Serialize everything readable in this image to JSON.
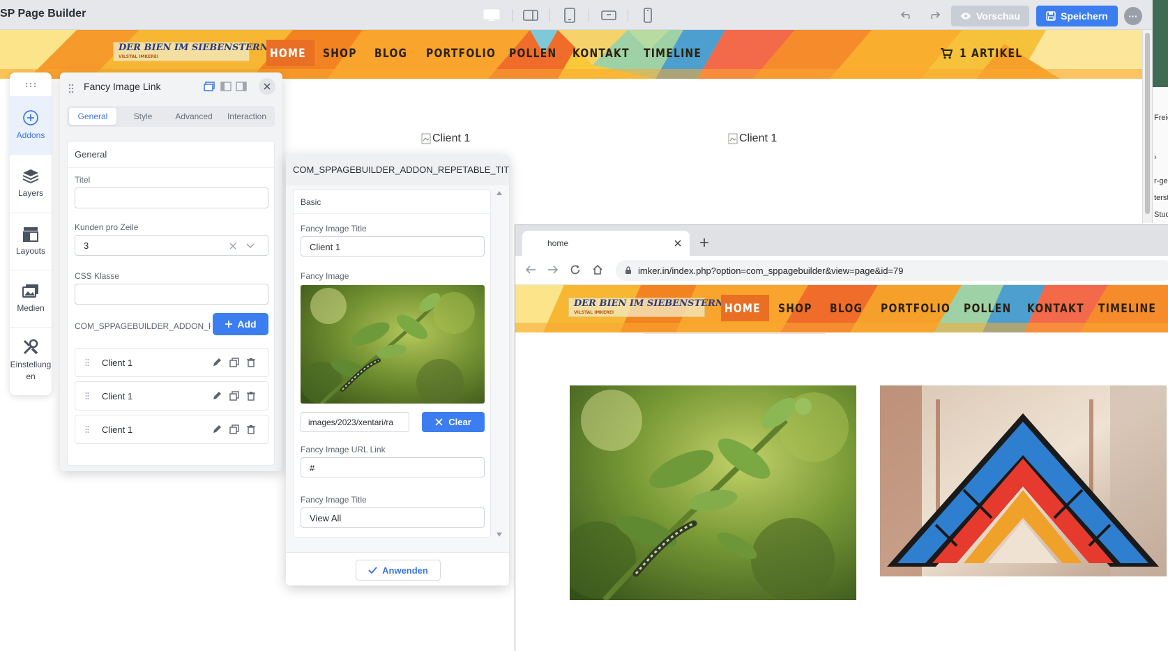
{
  "app": {
    "title": "SP Page Builder",
    "preview_label": "Vorschau",
    "save_label": "Speichern",
    "more_label": "···"
  },
  "site": {
    "logo_text": "DER BIEN IM SIEBENSTERN",
    "logo_sub": "VILSTAL IMKEREI",
    "nav": [
      "HOME",
      "SHOP",
      "BLOG",
      "PORTFOLIO",
      "POLLEN",
      "KONTAKT",
      "TIMELINE"
    ],
    "cart_label": "1 ARTIKEL",
    "client_images": [
      "Client 1",
      "Client 1"
    ]
  },
  "edge_texts": [
    "Freig",
    "›",
    "r-ge",
    "terst",
    "Stud"
  ],
  "sidebar": {
    "items": [
      {
        "label": "Addons"
      },
      {
        "label": "Layouts"
      },
      {
        "label": "Medien"
      },
      {
        "label": "Einstellungen"
      }
    ],
    "layers_label": "Layers",
    "einstell_line1": "Einstellung",
    "einstell_line2": "en"
  },
  "addon_panel": {
    "title": "Fancy Image Link",
    "tabs": [
      "General",
      "Style",
      "Advanced",
      "Interaction"
    ],
    "section": "General",
    "title_label": "Titel",
    "title_value": "",
    "kunden_label": "Kunden pro Zeile",
    "kunden_value": "3",
    "css_label": "CSS Klasse",
    "css_value": "",
    "repeatable_label": "COM_SPPAGEBUILDER_ADDON_REPETABLE_TITLE",
    "add_label": "Add",
    "items": [
      "Client 1",
      "Client 1",
      "Client 1"
    ]
  },
  "rep_modal": {
    "title": "COM_SPPAGEBUILDER_ADDON_REPETABLE_TITLE",
    "section": "Basic",
    "fancy_title_label": "Fancy Image Title",
    "fancy_title_value": "Client 1",
    "fancy_image_label": "Fancy Image",
    "image_path": "images/2023/xentari/ra",
    "clear_label": "Clear",
    "url_label": "Fancy Image URL Link",
    "url_value": "#",
    "fancy_title2_label": "Fancy Image Title",
    "fancy_title2_value": "View All",
    "apply_label": "Anwenden"
  },
  "browser": {
    "tab_title": "home",
    "url": "imker.in/index.php?option=com_sppagebuilder&view=page&id=79"
  }
}
